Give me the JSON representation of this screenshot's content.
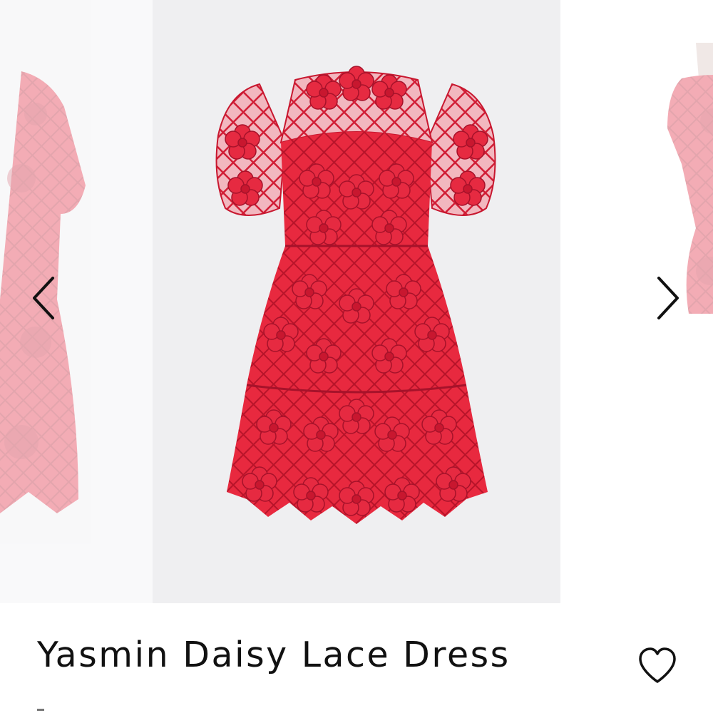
{
  "product": {
    "title": "Yasmin Daisy Lace Dress"
  },
  "gallery": {
    "images": [
      {
        "name": "previous-image",
        "description": "dress-side-view",
        "state": "faded"
      },
      {
        "name": "current-image",
        "description": "red-lace-dress-front",
        "state": "active"
      },
      {
        "name": "next-image",
        "description": "dress-on-mannequin",
        "state": "faded"
      }
    ],
    "prev_icon": "chevron-left-icon",
    "next_icon": "chevron-right-icon"
  },
  "wishlist": {
    "icon": "heart-icon"
  },
  "colors": {
    "dress_red": "#e2283f",
    "dress_dark": "#b8142a",
    "photo_bg": "#efeff1",
    "text": "#111111"
  }
}
